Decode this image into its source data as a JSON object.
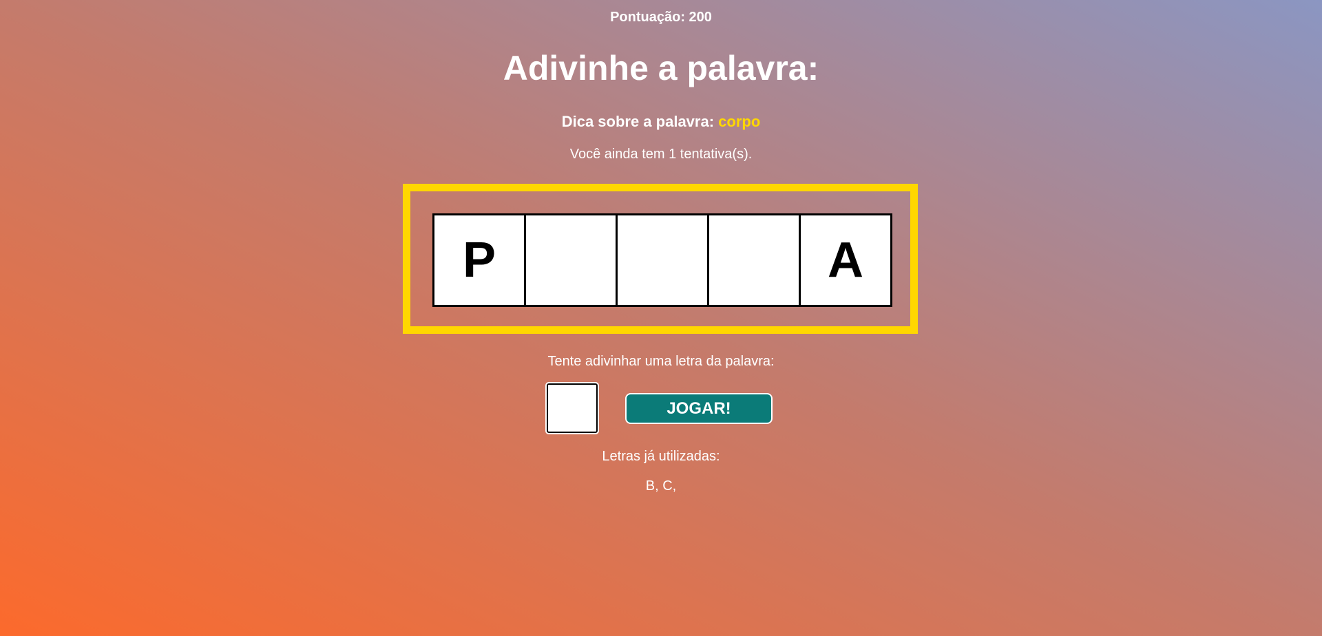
{
  "score": {
    "label": "Pontuação:",
    "value": "200"
  },
  "title": "Adivinhe a palavra:",
  "hint": {
    "label": "Dica sobre a palavra:",
    "value": "corpo"
  },
  "attempts_text": "Você ainda tem 1 tentativa(s).",
  "word_slots": [
    "P",
    "",
    "",
    "",
    "A"
  ],
  "guess": {
    "prompt": "Tente adivinhar uma letra da palavra:",
    "input_value": "",
    "button_label": "JOGAR!"
  },
  "used": {
    "label": "Letras já utilizadas:",
    "letters": "B, C,"
  },
  "colors": {
    "board_border": "#ffd700",
    "hint_value": "#ffd700",
    "button_bg": "#0b7b78",
    "gradient_start": "#fc6a2c",
    "gradient_end": "#8b96c2"
  }
}
